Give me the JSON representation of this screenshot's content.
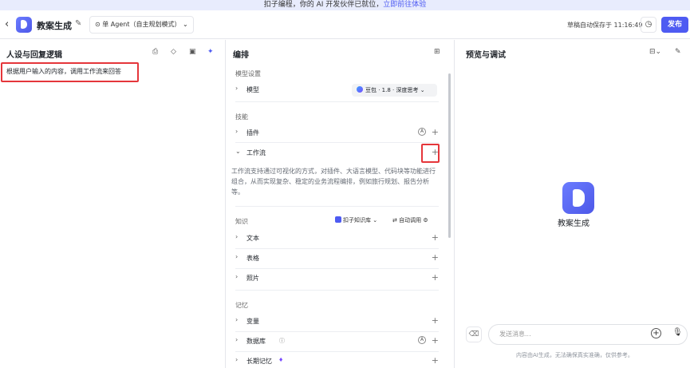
{
  "banner": {
    "text": "扣子编程，你的 AI 开发伙伴已就位，",
    "link": "立即前往体验"
  },
  "header": {
    "back_icon": "back-arrow-icon",
    "app_name": "教案生成",
    "mode_label": "单 Agent（自主规划模式）",
    "autosave": "草稿自动保存于 11:16:49",
    "publish_label": "发布"
  },
  "left": {
    "title": "人设与回复逻辑",
    "prompt": "根据用户输入的内容，调用工作流来回答"
  },
  "mid": {
    "title": "编排",
    "model_section": "模型设置",
    "model_label": "模型",
    "model_value": "豆包 · 1.8 · 深度思考",
    "skills_section": "技能",
    "plugin_label": "插件",
    "workflow_label": "工作流",
    "workflow_desc": "工作流支持通过可视化的方式，对插件、大语言模型、代码块等功能进行组合，从而实现复杂、稳定的业务流程编排，例如旅行规划、报告分析等。",
    "knowledge_section": "知识",
    "kb_label": "扣子知识库",
    "auto_call_label": "自动调用",
    "text_label": "文本",
    "table_label": "表格",
    "photo_label": "照片",
    "memory_section": "记忆",
    "variable_label": "变量",
    "database_label": "数据库",
    "longterm_label": "长期记忆"
  },
  "right": {
    "title": "预览与调试",
    "bot_name": "教案生成",
    "input_placeholder": "发送消息...",
    "disclaimer": "内容由AI生成，无法确保真实准确，仅供参考。"
  },
  "colors": {
    "accent": "#4e5bf2",
    "highlight": "#e5363b"
  }
}
